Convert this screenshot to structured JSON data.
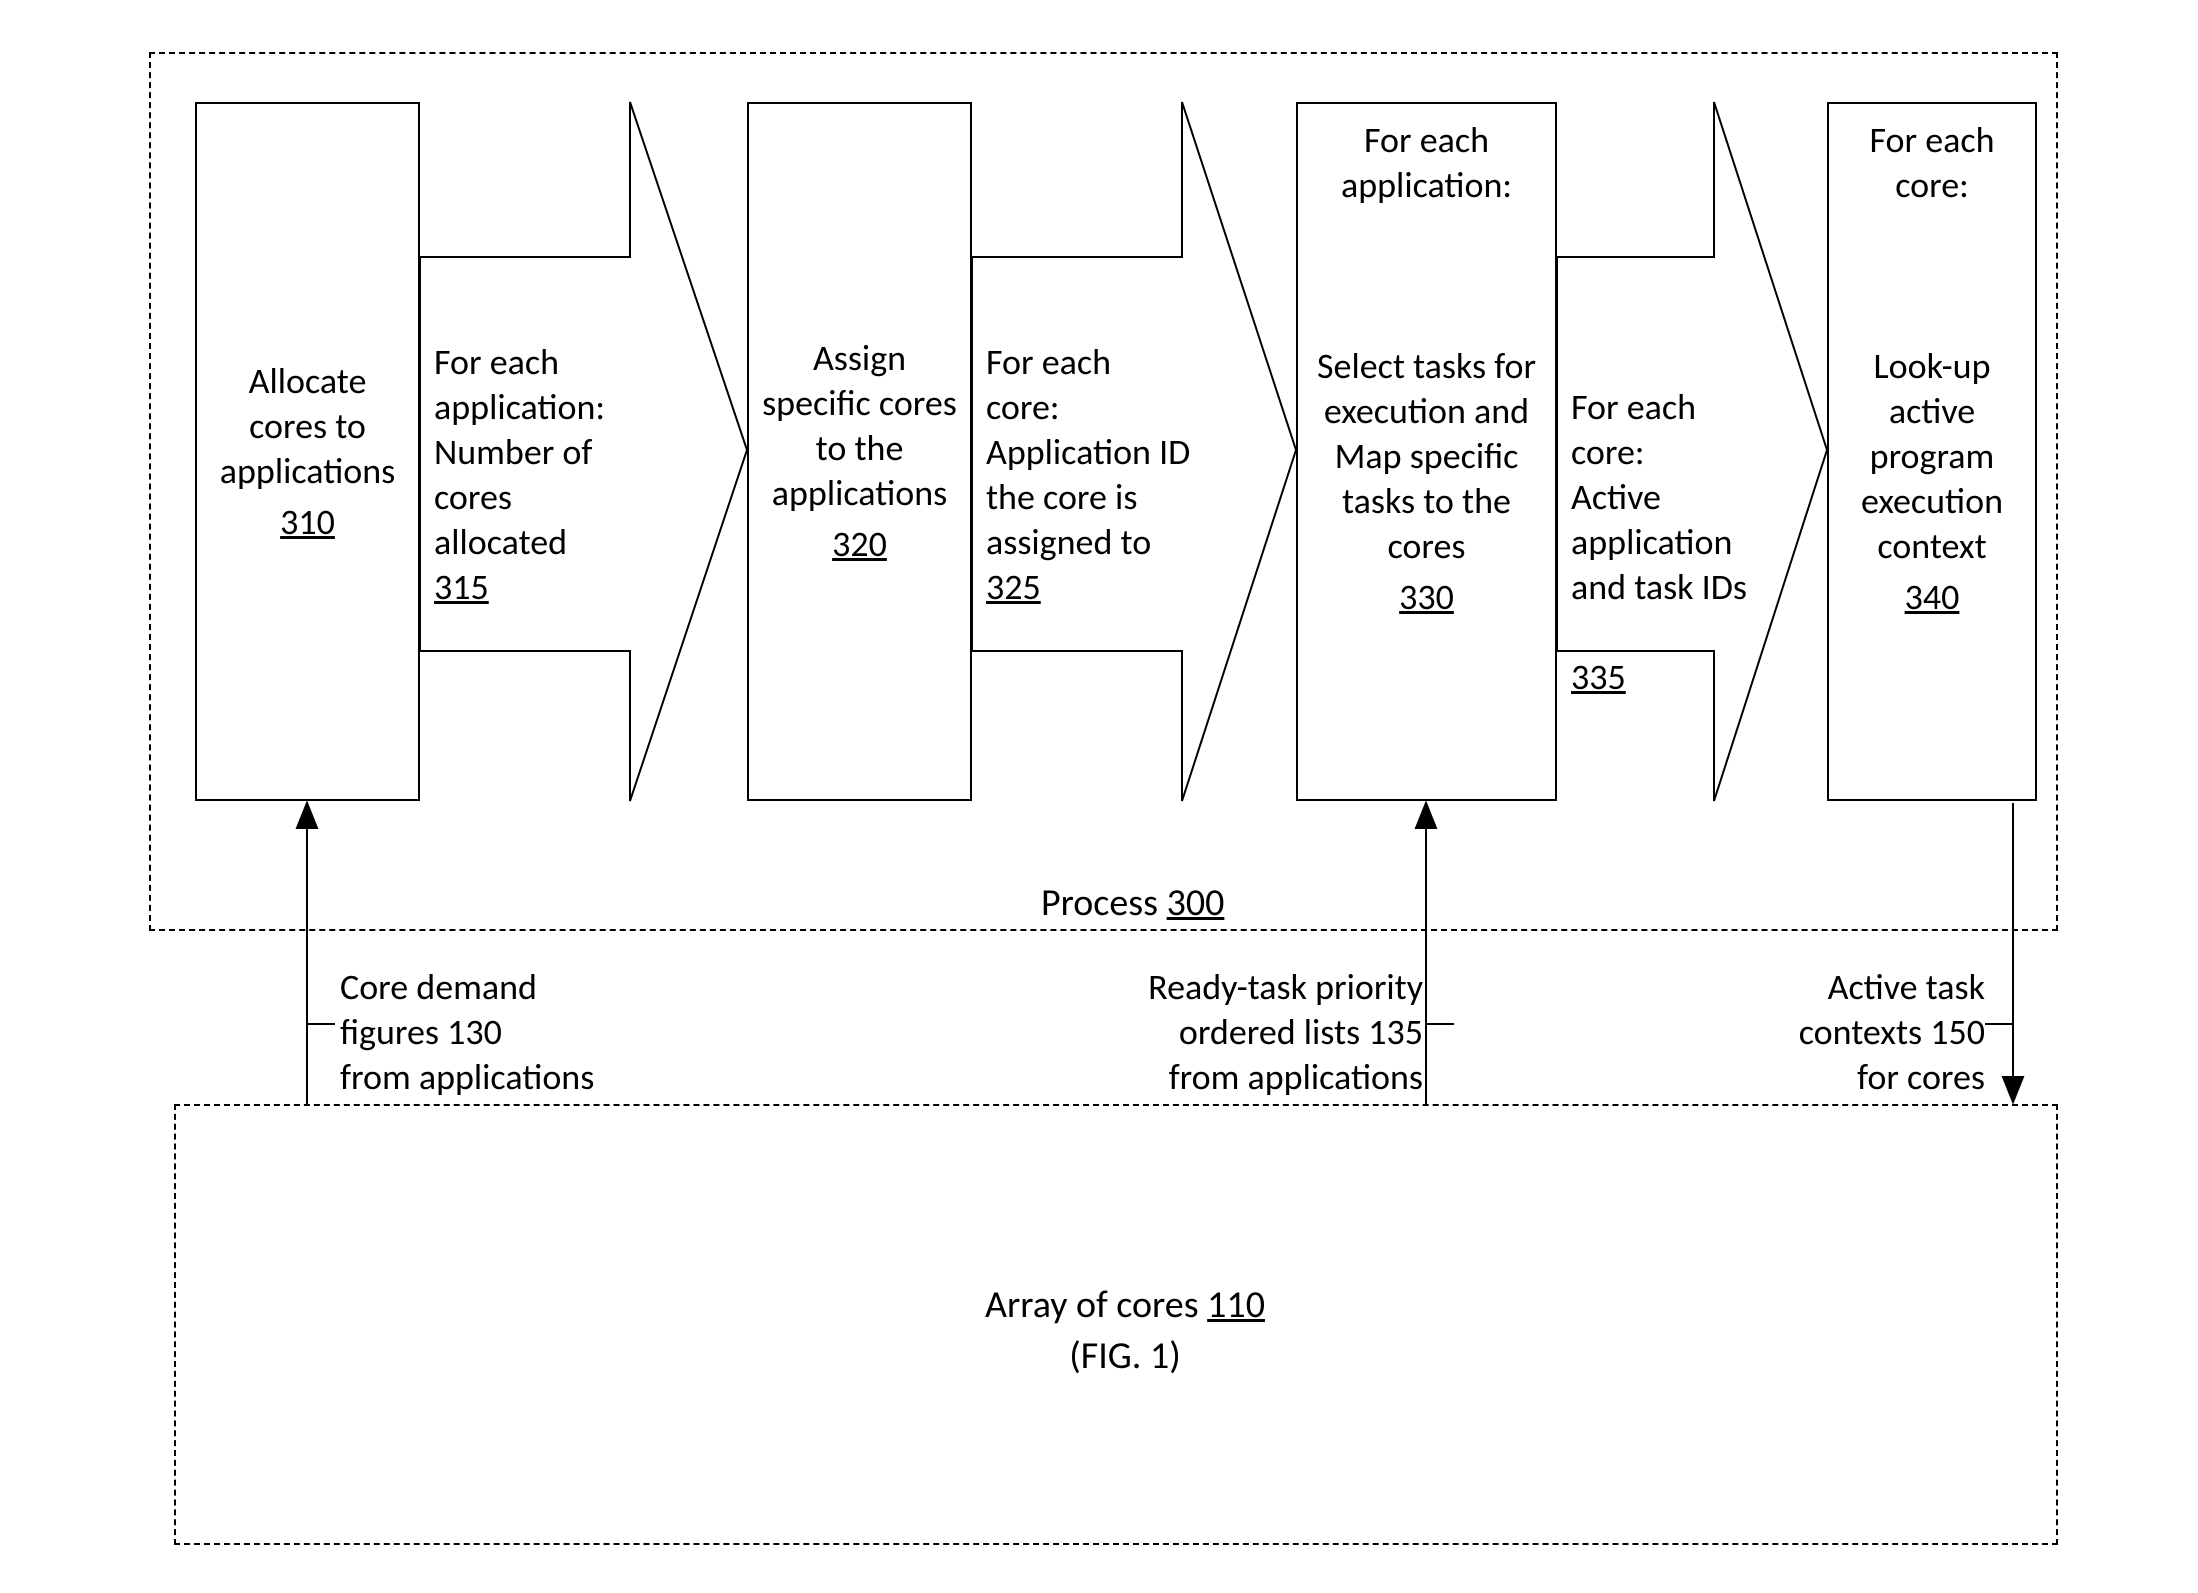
{
  "process": {
    "label": "Process",
    "ref": "300"
  },
  "steps": {
    "s310": {
      "text": "Allocate cores to applications",
      "ref": "310"
    },
    "s320": {
      "text": "Assign specific cores to the applications",
      "ref": "320"
    },
    "s330": {
      "header": "For each application:",
      "text": "Select tasks for execution and\nMap specific tasks to the cores",
      "ref": "330"
    },
    "s340": {
      "header": "For each core:",
      "text": "Look-up active program execution context",
      "ref": "340"
    }
  },
  "arrows": {
    "a315": {
      "text": "For each application: Number of cores allocated",
      "ref": "315"
    },
    "a325": {
      "text": "For each core: Application ID the core is assigned to",
      "ref": "325"
    },
    "a335": {
      "text": "For each core:\nActive application and task IDs",
      "ref": "335"
    }
  },
  "inputs": {
    "i130": {
      "line1": "Core demand",
      "line2": "figures 130",
      "line3": "from applications"
    },
    "i135": {
      "line1": "Ready-task priority",
      "line2": "ordered lists 135",
      "line3": "from applications"
    },
    "i150": {
      "line1": "Active task",
      "line2": "contexts 150",
      "line3": "for cores"
    }
  },
  "array": {
    "label": "Array of cores",
    "ref": "110",
    "sub": "(FIG. 1)"
  }
}
